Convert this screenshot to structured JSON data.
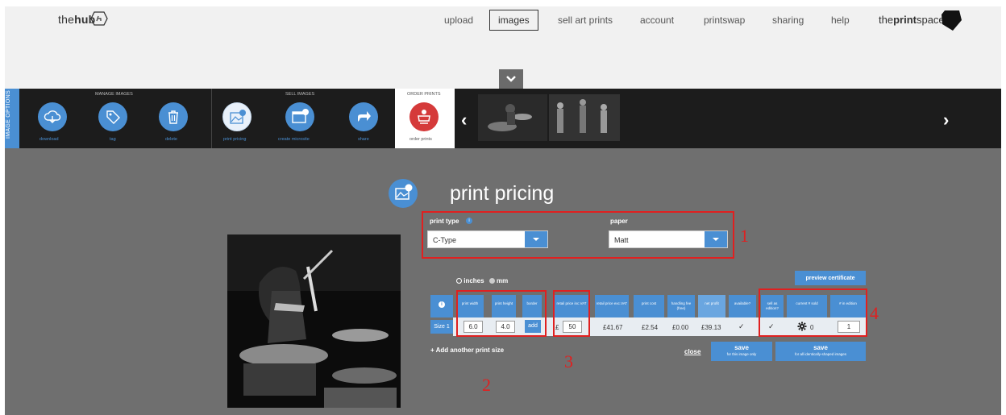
{
  "app": {
    "logo_prefix": "the",
    "logo_bold": "hub",
    "brand_prefix": "the",
    "brand_bold": "print",
    "brand_suffix": "space"
  },
  "nav": {
    "items": [
      {
        "label": "upload",
        "active": false
      },
      {
        "label": "images",
        "active": true
      },
      {
        "label": "sell art prints",
        "active": false
      },
      {
        "label": "account",
        "active": false
      },
      {
        "label": "printswap",
        "active": false
      },
      {
        "label": "sharing",
        "active": false
      },
      {
        "label": "help",
        "active": false
      }
    ]
  },
  "options": {
    "side_label": "IMAGE OPTIONS",
    "groups": {
      "manage": "MANAGE IMAGES",
      "sell": "SELL IMAGES",
      "order": "ORDER PRINTS"
    },
    "buttons": {
      "download": "download",
      "tag": "tag",
      "delete": "delete",
      "print_pricing": "print pricing",
      "create_microsite": "create microsite",
      "share": "share",
      "order_prints": "order prints"
    }
  },
  "pricing": {
    "title": "print pricing",
    "print_type_label": "print type",
    "print_type_value": "C-Type",
    "paper_label": "paper",
    "paper_value": "Matt",
    "units_inches": "inches",
    "units_mm": "mm",
    "selected_unit": "inches",
    "preview_certificate": "preview certificate",
    "columns": {
      "print_width": "print width",
      "print_height": "print height",
      "border": "border",
      "retail_inc": "retail price inc.VAT",
      "retail_exc": "retail price exc.VAT",
      "print_cost": "print cost",
      "handling": "handling fee (free)",
      "net_profit": "net profit",
      "available": "available?",
      "sell_edition": "sell as edition?",
      "current_sold": "current # sold",
      "in_edition": "# in edition"
    },
    "row": {
      "label": "Size 1",
      "width": "6.0",
      "height": "4.0",
      "border_btn": "add",
      "currency": "£",
      "retail_inc": "50",
      "retail_exc": "£41.67",
      "print_cost": "£2.54",
      "handling": "£0.00",
      "net_profit": "£39.13",
      "available": "✓",
      "sell_edition": "✓",
      "sold": "0",
      "in_edition": "1"
    },
    "add_size": "+ Add another print size",
    "close": "close",
    "save_main": "save",
    "save_this": "for this image only",
    "save_all": "for all identically-shaped images"
  },
  "annotations": {
    "a1": "1",
    "a2": "2",
    "a3": "3",
    "a4": "4"
  },
  "colors": {
    "accent": "#4a8fd3",
    "annotation": "#e02020",
    "main_bg": "#6f6f6f",
    "order": "#d53a3a"
  }
}
